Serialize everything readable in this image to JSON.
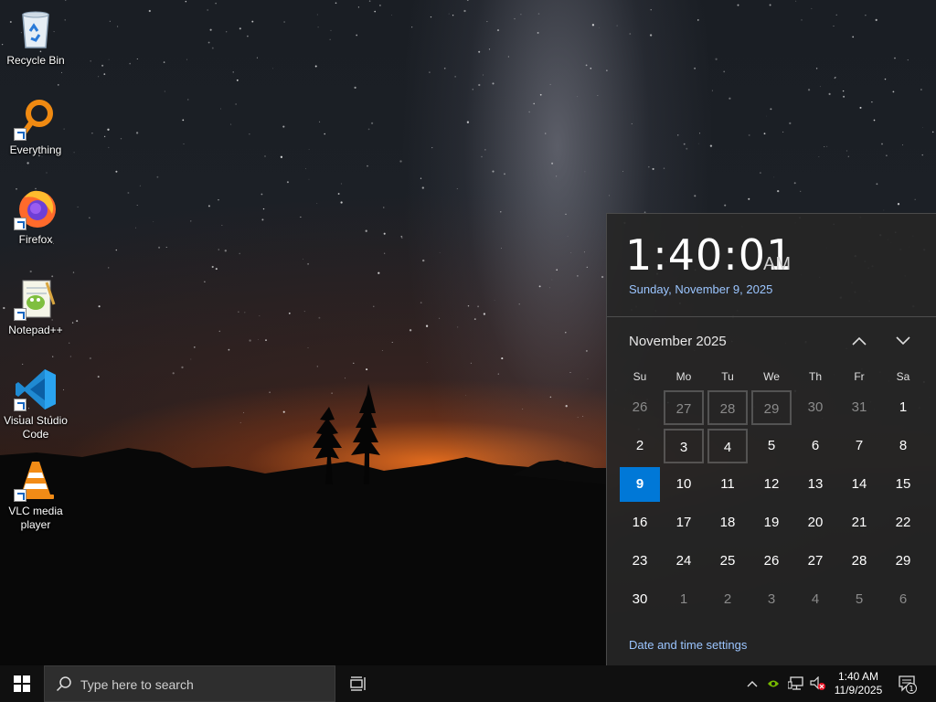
{
  "desktop": {
    "icons": [
      {
        "label": "Recycle Bin",
        "icon": "recycle-bin-icon"
      },
      {
        "label": "Everything",
        "icon": "everything-search-icon"
      },
      {
        "label": "Firefox",
        "icon": "firefox-icon"
      },
      {
        "label": "Notepad++",
        "icon": "notepadpp-icon"
      },
      {
        "label": "Visual Studio Code",
        "icon": "vscode-icon"
      },
      {
        "label": "VLC media player",
        "icon": "vlc-icon"
      }
    ]
  },
  "flyout": {
    "time": "1:40:01",
    "ampm": "AM",
    "date": "Sunday, November 9, 2025",
    "month_label": "November 2025",
    "weekdays": [
      "Su",
      "Mo",
      "Tu",
      "We",
      "Th",
      "Fr",
      "Sa"
    ],
    "weeks": [
      [
        "26",
        "27",
        "28",
        "29",
        "30",
        "31",
        "1"
      ],
      [
        "2",
        "3",
        "4",
        "5",
        "6",
        "7",
        "8"
      ],
      [
        "9",
        "10",
        "11",
        "12",
        "13",
        "14",
        "15"
      ],
      [
        "16",
        "17",
        "18",
        "19",
        "20",
        "21",
        "22"
      ],
      [
        "23",
        "24",
        "25",
        "26",
        "27",
        "28",
        "29"
      ],
      [
        "30",
        "1",
        "2",
        "3",
        "4",
        "5",
        "6"
      ]
    ],
    "today": "9",
    "settings_link": "Date and time settings",
    "accent_color": "#0078d7",
    "link_color": "#9bc5ff"
  },
  "taskbar": {
    "search_placeholder": "Type here to search",
    "clock_time": "1:40 AM",
    "clock_date": "11/9/2025",
    "notification_count": "1"
  }
}
